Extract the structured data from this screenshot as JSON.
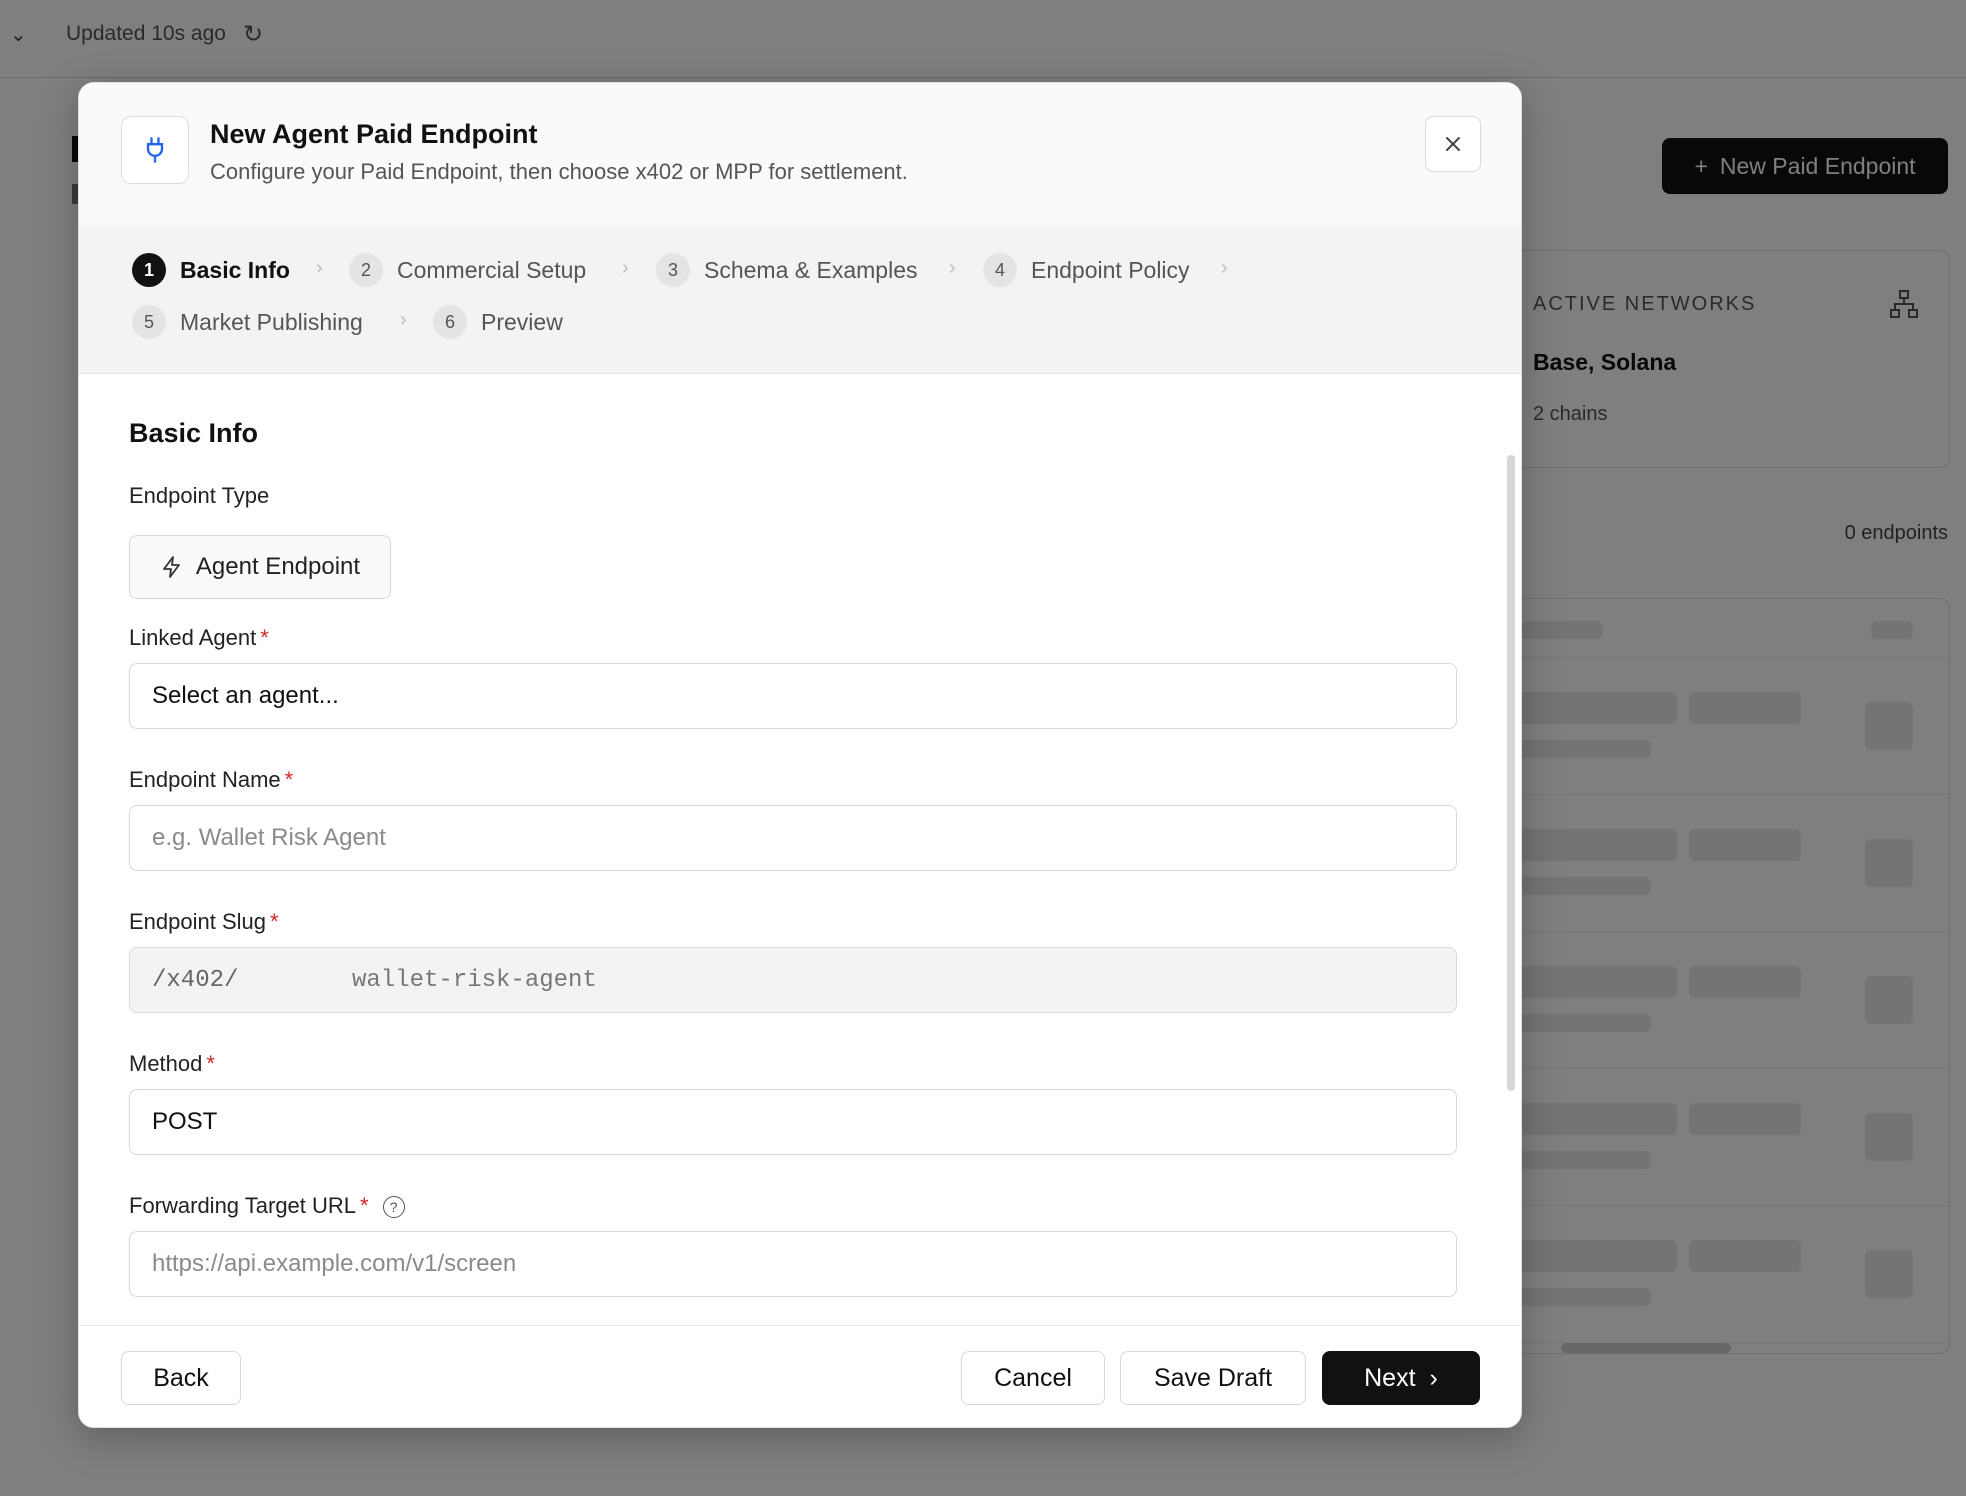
{
  "background": {
    "updated_text": "Updated 10s ago",
    "new_button_label": "New Paid Endpoint",
    "networks_card": {
      "label": "ACTIVE NETWORKS",
      "value": "Base, Solana",
      "sub": "2 chains"
    },
    "endpoint_count": "0 endpoints"
  },
  "modal": {
    "title": "New Agent Paid Endpoint",
    "subtitle": "Configure your Paid Endpoint, then choose x402 or MPP for settlement.",
    "steps": [
      {
        "num": "1",
        "label": "Basic Info"
      },
      {
        "num": "2",
        "label": "Commercial Setup"
      },
      {
        "num": "3",
        "label": "Schema & Examples"
      },
      {
        "num": "4",
        "label": "Endpoint Policy"
      },
      {
        "num": "5",
        "label": "Market Publishing"
      },
      {
        "num": "6",
        "label": "Preview"
      }
    ],
    "section_title": "Basic Info",
    "endpoint_type": {
      "label": "Endpoint Type",
      "value": "Agent Endpoint"
    },
    "linked_agent": {
      "label": "Linked Agent",
      "value": "Select an agent..."
    },
    "endpoint_name": {
      "label": "Endpoint Name",
      "placeholder": "e.g. Wallet Risk Agent"
    },
    "endpoint_slug": {
      "label": "Endpoint Slug",
      "prefix": "/x402/",
      "placeholder": "wallet-risk-agent"
    },
    "method": {
      "label": "Method",
      "value": "POST"
    },
    "forwarding_url": {
      "label": "Forwarding Target URL",
      "placeholder": "https://api.example.com/v1/screen"
    },
    "required_mark": "*",
    "footer": {
      "back": "Back",
      "cancel": "Cancel",
      "save_draft": "Save Draft",
      "next": "Next"
    }
  },
  "colors": {
    "primary": "#111111",
    "required": "#d32626",
    "overlay": "rgba(0,0,0,0.5)"
  },
  "icons": [
    "chevron-down-icon",
    "refresh-icon",
    "plus-icon",
    "network-icon",
    "plug-icon",
    "close-icon",
    "lightning-icon",
    "help-icon",
    "chevron-right-icon"
  ]
}
